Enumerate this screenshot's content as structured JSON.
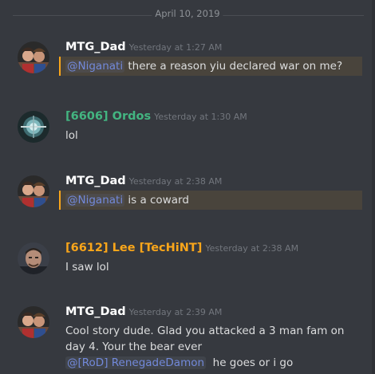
{
  "date_divider": "April 10, 2019",
  "messages": [
    {
      "username": "MTG_Dad",
      "username_color": "#ffffff",
      "timestamp": "Yesterday at 1:27 AM",
      "mention": "@Niganati",
      "text": "there a reason yiu declared war on me?",
      "highlighted": true,
      "avatar": "mtg-dad-avatar"
    },
    {
      "username": "[6606] Ordos",
      "username_color": "#43b581",
      "timestamp": "Yesterday at 1:30 AM",
      "text": "lol",
      "avatar": "ordos-avatar"
    },
    {
      "username": "MTG_Dad",
      "username_color": "#ffffff",
      "timestamp": "Yesterday at 2:38 AM",
      "mention": "@Niganati",
      "text": "is a coward",
      "highlighted": true,
      "avatar": "mtg-dad-avatar"
    },
    {
      "username": "[6612] Lee [TecHiNT]",
      "username_color": "#faa61a",
      "timestamp": "Yesterday at 2:38 AM",
      "text": "I saw lol",
      "avatar": "lee-avatar"
    },
    {
      "username": "MTG_Dad",
      "username_color": "#ffffff",
      "timestamp": "Yesterday at 2:39 AM",
      "lines": [
        "Cool story dude.  Glad you attacked a 3 man fam on",
        "day 4.  Your the bear ever"
      ],
      "mention": "@[RoD] RenegadeDamon",
      "text": "he goes or i go",
      "avatar": "mtg-dad-avatar"
    }
  ],
  "colors": {
    "background": "#36393f",
    "mention_highlight": "#49443c",
    "mention_bar": "#faa61a",
    "mention_text": "#7289da",
    "timestamp": "#72767d"
  }
}
